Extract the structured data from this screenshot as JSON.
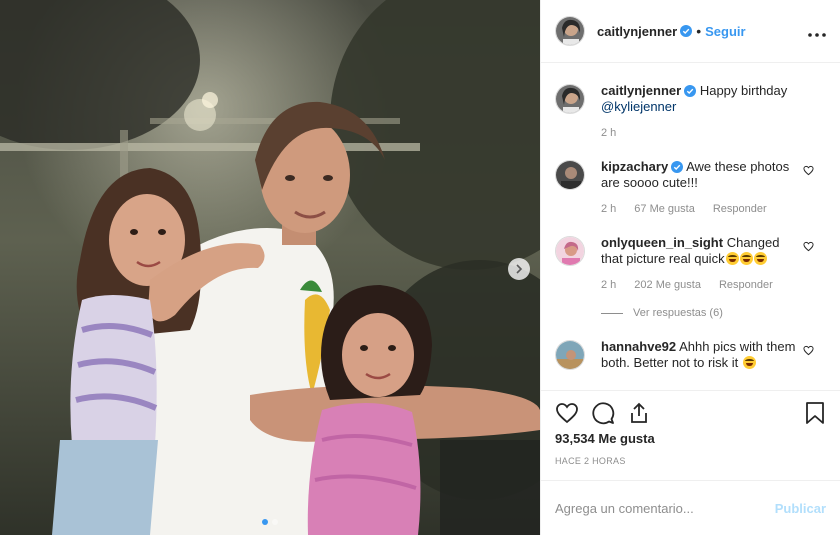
{
  "post": {
    "author": "caitlynjenner",
    "follow_label": "Seguir",
    "separator": "•",
    "more_icon": "more-horizontal-icon",
    "image": {
      "next_icon": "chevron-right-icon",
      "carousel_total": 2,
      "carousel_active": 1
    }
  },
  "caption": {
    "username": "caitlynjenner",
    "text": "Happy birthday",
    "mention": "@kyliejenner",
    "time": "2 h"
  },
  "comments": [
    {
      "username": "kipzachary",
      "verified": true,
      "text": "Awe these photos are soooo cute!!!",
      "time": "2 h",
      "likes": "67 Me gusta",
      "reply": "Responder"
    },
    {
      "username": "onlyqueen_in_sight",
      "verified": false,
      "text": "Changed that picture real quick",
      "time": "2 h",
      "likes": "202 Me gusta",
      "reply": "Responder",
      "view_replies": "Ver respuestas (6)"
    },
    {
      "username": "hannahve92",
      "verified": false,
      "text": "Ahhh pics with them both. Better not to risk it"
    }
  ],
  "actions": {
    "like_icon": "heart-icon",
    "comment_icon": "comment-icon",
    "share_icon": "share-icon",
    "save_icon": "bookmark-icon",
    "likes_count": "93,534 Me gusta",
    "time_ago": "HACE 2 HORAS"
  },
  "add_comment": {
    "placeholder": "Agrega un comentario...",
    "post_label": "Publicar"
  },
  "colors": {
    "accent": "#3897f0",
    "verified": "#3897f0",
    "post_disabled": "#b2dffc",
    "muted": "#8e8e8e"
  }
}
